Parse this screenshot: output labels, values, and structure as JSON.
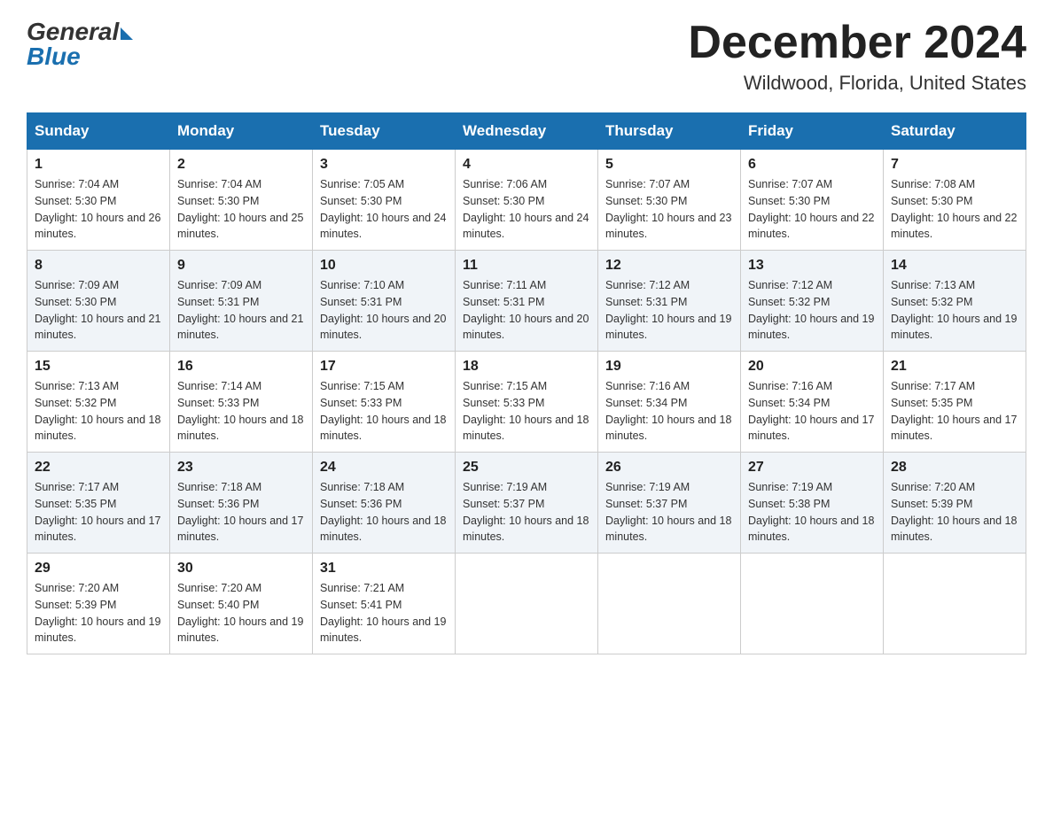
{
  "header": {
    "logo_general": "General",
    "logo_blue": "Blue",
    "month_title": "December 2024",
    "location": "Wildwood, Florida, United States"
  },
  "calendar": {
    "days_of_week": [
      "Sunday",
      "Monday",
      "Tuesday",
      "Wednesday",
      "Thursday",
      "Friday",
      "Saturday"
    ],
    "weeks": [
      [
        {
          "day": "1",
          "sunrise": "7:04 AM",
          "sunset": "5:30 PM",
          "daylight": "10 hours and 26 minutes."
        },
        {
          "day": "2",
          "sunrise": "7:04 AM",
          "sunset": "5:30 PM",
          "daylight": "10 hours and 25 minutes."
        },
        {
          "day": "3",
          "sunrise": "7:05 AM",
          "sunset": "5:30 PM",
          "daylight": "10 hours and 24 minutes."
        },
        {
          "day": "4",
          "sunrise": "7:06 AM",
          "sunset": "5:30 PM",
          "daylight": "10 hours and 24 minutes."
        },
        {
          "day": "5",
          "sunrise": "7:07 AM",
          "sunset": "5:30 PM",
          "daylight": "10 hours and 23 minutes."
        },
        {
          "day": "6",
          "sunrise": "7:07 AM",
          "sunset": "5:30 PM",
          "daylight": "10 hours and 22 minutes."
        },
        {
          "day": "7",
          "sunrise": "7:08 AM",
          "sunset": "5:30 PM",
          "daylight": "10 hours and 22 minutes."
        }
      ],
      [
        {
          "day": "8",
          "sunrise": "7:09 AM",
          "sunset": "5:30 PM",
          "daylight": "10 hours and 21 minutes."
        },
        {
          "day": "9",
          "sunrise": "7:09 AM",
          "sunset": "5:31 PM",
          "daylight": "10 hours and 21 minutes."
        },
        {
          "day": "10",
          "sunrise": "7:10 AM",
          "sunset": "5:31 PM",
          "daylight": "10 hours and 20 minutes."
        },
        {
          "day": "11",
          "sunrise": "7:11 AM",
          "sunset": "5:31 PM",
          "daylight": "10 hours and 20 minutes."
        },
        {
          "day": "12",
          "sunrise": "7:12 AM",
          "sunset": "5:31 PM",
          "daylight": "10 hours and 19 minutes."
        },
        {
          "day": "13",
          "sunrise": "7:12 AM",
          "sunset": "5:32 PM",
          "daylight": "10 hours and 19 minutes."
        },
        {
          "day": "14",
          "sunrise": "7:13 AM",
          "sunset": "5:32 PM",
          "daylight": "10 hours and 19 minutes."
        }
      ],
      [
        {
          "day": "15",
          "sunrise": "7:13 AM",
          "sunset": "5:32 PM",
          "daylight": "10 hours and 18 minutes."
        },
        {
          "day": "16",
          "sunrise": "7:14 AM",
          "sunset": "5:33 PM",
          "daylight": "10 hours and 18 minutes."
        },
        {
          "day": "17",
          "sunrise": "7:15 AM",
          "sunset": "5:33 PM",
          "daylight": "10 hours and 18 minutes."
        },
        {
          "day": "18",
          "sunrise": "7:15 AM",
          "sunset": "5:33 PM",
          "daylight": "10 hours and 18 minutes."
        },
        {
          "day": "19",
          "sunrise": "7:16 AM",
          "sunset": "5:34 PM",
          "daylight": "10 hours and 18 minutes."
        },
        {
          "day": "20",
          "sunrise": "7:16 AM",
          "sunset": "5:34 PM",
          "daylight": "10 hours and 17 minutes."
        },
        {
          "day": "21",
          "sunrise": "7:17 AM",
          "sunset": "5:35 PM",
          "daylight": "10 hours and 17 minutes."
        }
      ],
      [
        {
          "day": "22",
          "sunrise": "7:17 AM",
          "sunset": "5:35 PM",
          "daylight": "10 hours and 17 minutes."
        },
        {
          "day": "23",
          "sunrise": "7:18 AM",
          "sunset": "5:36 PM",
          "daylight": "10 hours and 17 minutes."
        },
        {
          "day": "24",
          "sunrise": "7:18 AM",
          "sunset": "5:36 PM",
          "daylight": "10 hours and 18 minutes."
        },
        {
          "day": "25",
          "sunrise": "7:19 AM",
          "sunset": "5:37 PM",
          "daylight": "10 hours and 18 minutes."
        },
        {
          "day": "26",
          "sunrise": "7:19 AM",
          "sunset": "5:37 PM",
          "daylight": "10 hours and 18 minutes."
        },
        {
          "day": "27",
          "sunrise": "7:19 AM",
          "sunset": "5:38 PM",
          "daylight": "10 hours and 18 minutes."
        },
        {
          "day": "28",
          "sunrise": "7:20 AM",
          "sunset": "5:39 PM",
          "daylight": "10 hours and 18 minutes."
        }
      ],
      [
        {
          "day": "29",
          "sunrise": "7:20 AM",
          "sunset": "5:39 PM",
          "daylight": "10 hours and 19 minutes."
        },
        {
          "day": "30",
          "sunrise": "7:20 AM",
          "sunset": "5:40 PM",
          "daylight": "10 hours and 19 minutes."
        },
        {
          "day": "31",
          "sunrise": "7:21 AM",
          "sunset": "5:41 PM",
          "daylight": "10 hours and 19 minutes."
        },
        null,
        null,
        null,
        null
      ]
    ]
  }
}
